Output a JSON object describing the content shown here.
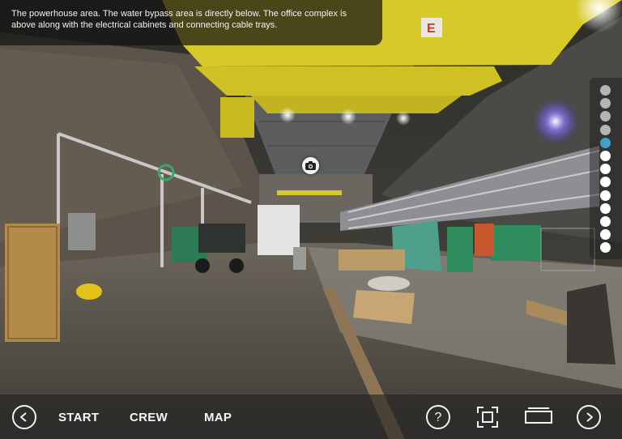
{
  "caption": "The powerhouse area. The water bypass area is directly below. The office complex is above along with the electrical cabinets and connecting cable trays.",
  "toolbar": {
    "start_label": "START",
    "crew_label": "CREW",
    "map_label": "MAP"
  },
  "icons": {
    "previous": "chevron-left-icon",
    "next": "chevron-right-icon",
    "help": "question-icon",
    "fullscreen": "fullscreen-icon",
    "window": "window-icon",
    "camera": "camera-icon"
  },
  "help_glyph": "?",
  "scene_signage": "E",
  "scene_nav": {
    "total": 13,
    "active_index": 4,
    "colors": {
      "visited": "#b5b5b5",
      "active": "#3fa0c8",
      "unvisited": "#ffffff"
    }
  }
}
